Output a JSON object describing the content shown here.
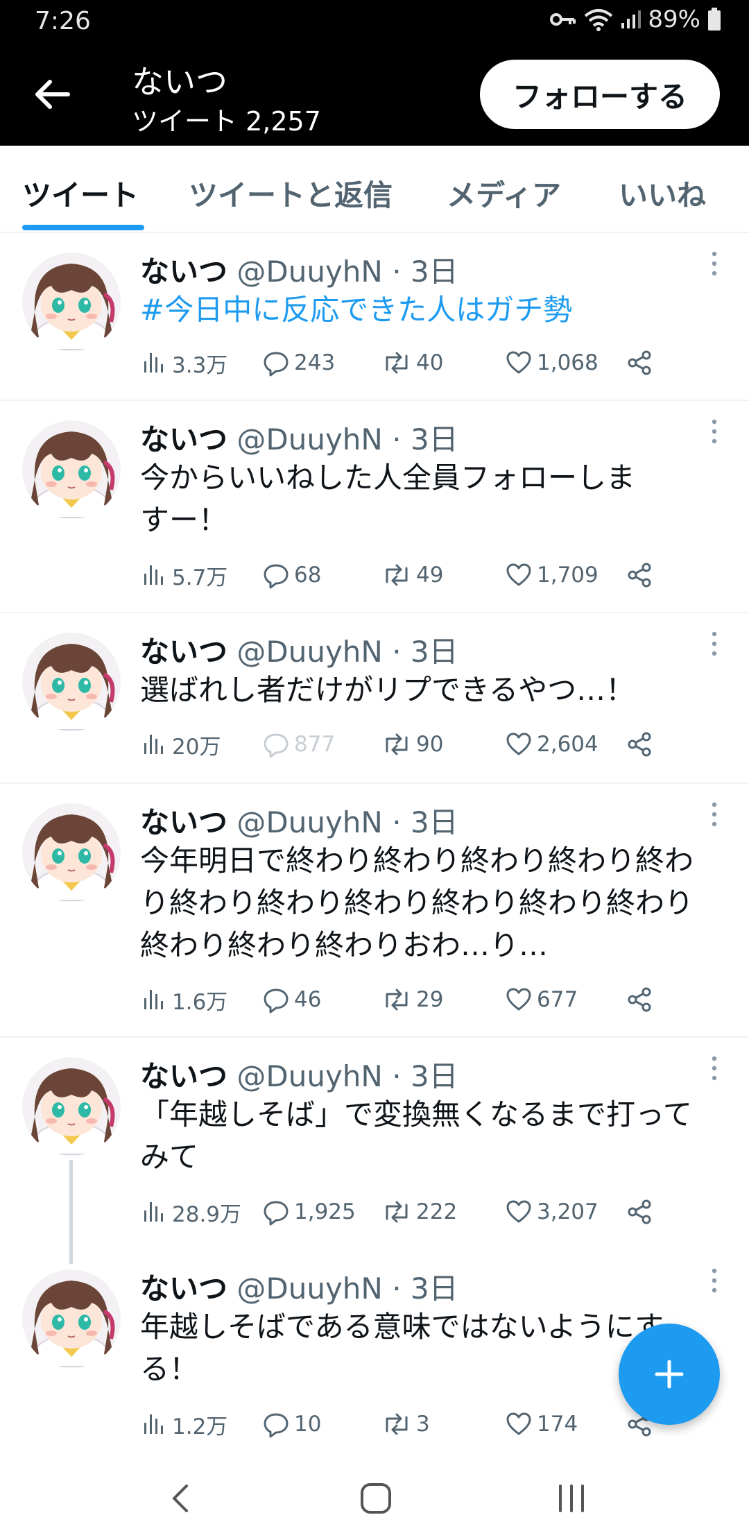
{
  "status_bar": {
    "time": "7:26",
    "battery": "89%"
  },
  "header": {
    "name": "ないつ",
    "tweet_count": "ツイート 2,257",
    "follow_label": "フォローする"
  },
  "tabs": [
    {
      "label": "ツイート"
    },
    {
      "label": "ツイートと返信"
    },
    {
      "label": "メディア"
    },
    {
      "label": "いいね"
    }
  ],
  "tweets": [
    {
      "name": "ないつ",
      "handle": "@DuuyhN",
      "dot": "·",
      "time": "3日",
      "text": "#今日中に反応できた人はガチ勢",
      "views": "3.3万",
      "replies": "243",
      "retweets": "40",
      "likes": "1,068"
    },
    {
      "name": "ないつ",
      "handle": "@DuuyhN",
      "dot": "·",
      "time": "3日",
      "text": "今からいいねした人全員フォローしま\nすー！",
      "views": "5.7万",
      "replies": "68",
      "retweets": "49",
      "likes": "1,709"
    },
    {
      "name": "ないつ",
      "handle": "@DuuyhN",
      "dot": "·",
      "time": "3日",
      "text": "選ばれし者だけがリプできるやつ…！",
      "views": "20万",
      "replies": "877",
      "retweets": "90",
      "likes": "2,604"
    },
    {
      "name": "ないつ",
      "handle": "@DuuyhN",
      "dot": "·",
      "time": "3日",
      "text": "今年明日で終わり終わり終わり終わり終わ\nり終わり終わり終わり終わり終わり終わり\n終わり終わり終わりおわ…り…",
      "views": "1.6万",
      "replies": "46",
      "retweets": "29",
      "likes": "677"
    },
    {
      "name": "ないつ",
      "handle": "@DuuyhN",
      "dot": "·",
      "time": "3日",
      "text": "「年越しそば」で変換無くなるまで打って\nみて",
      "views": "28.9万",
      "replies": "1,925",
      "retweets": "222",
      "likes": "3,207"
    },
    {
      "name": "ないつ",
      "handle": "@DuuyhN",
      "dot": "·",
      "time": "3日",
      "text": "年越しそばである意味ではないようにす\nる！",
      "views": "1.2万",
      "replies": "10",
      "retweets": "3",
      "likes": "174"
    }
  ],
  "colors": {
    "accent": "#1d9bf0",
    "header_bg": "#000000",
    "secondary_text": "#536471"
  }
}
